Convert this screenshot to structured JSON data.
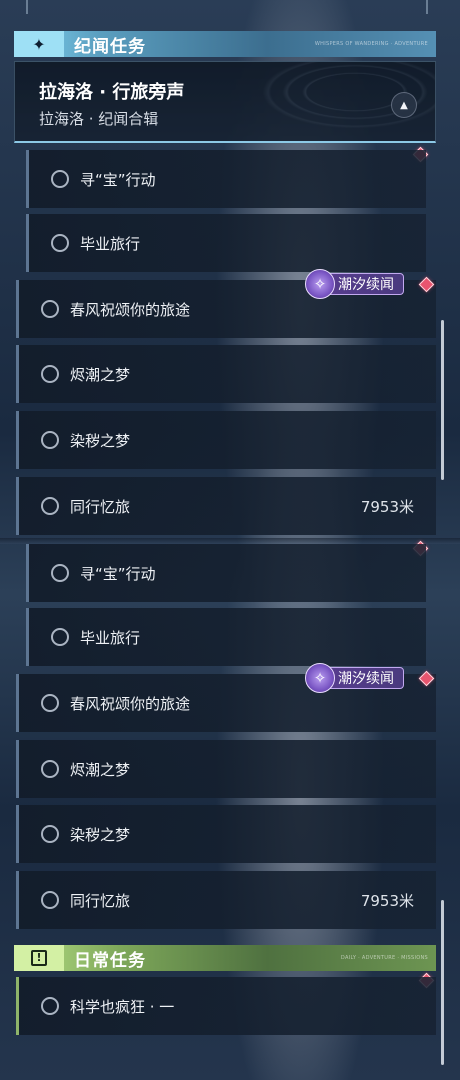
{
  "colors": {
    "marker": "#e8556f",
    "tide_badge": "#5a3d92",
    "category_blue": "#7fd1ef",
    "category_green": "#b7df86"
  },
  "category_story": {
    "label": "纪闻任务",
    "icon": "sparkle-icon",
    "deco": "WHISPERS OF WANDERING · ADVENTURE"
  },
  "series": {
    "title": "拉海洛 · 行旅旁声",
    "subtitle": "拉海洛 · 纪闻合辑",
    "toggle_icon": "collapse-arrow-icon"
  },
  "tide_badge": {
    "label": "潮汐续闻",
    "icon": "tide-swirl-icon"
  },
  "group1": {
    "quests": [
      {
        "label": "寻“宝”行动"
      },
      {
        "label": "毕业旅行"
      },
      {
        "label": "春风祝颂你的旅途"
      },
      {
        "label": "烬潮之梦"
      },
      {
        "label": "染秽之梦"
      },
      {
        "label": "同行忆旅",
        "distance": "7953米"
      }
    ]
  },
  "group2": {
    "quests": [
      {
        "label": "寻“宝”行动"
      },
      {
        "label": "毕业旅行"
      },
      {
        "label": "春风祝颂你的旅途"
      },
      {
        "label": "烬潮之梦"
      },
      {
        "label": "染秽之梦"
      },
      {
        "label": "同行忆旅",
        "distance": "7953米"
      }
    ]
  },
  "category_daily": {
    "label": "日常任务",
    "icon": "exclamation-icon",
    "deco": "DAILY · ADVENTURE · MISSIONS"
  },
  "daily": {
    "quests": [
      {
        "label": "科学也疯狂 · 一"
      }
    ]
  }
}
